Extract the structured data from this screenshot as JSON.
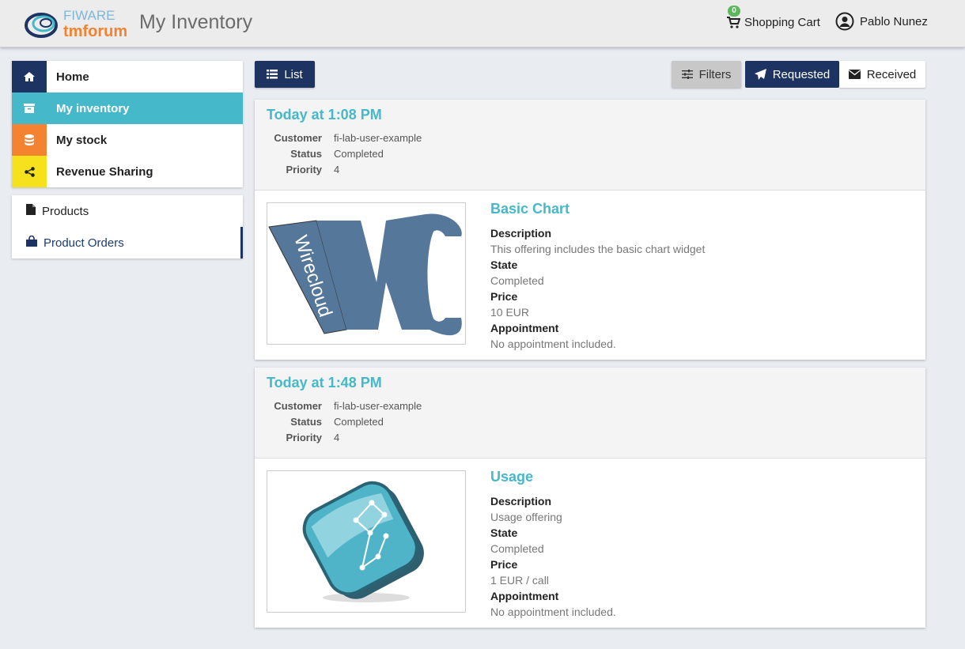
{
  "header": {
    "logo_top": "FIWARE",
    "logo_bottom": "tmforum",
    "title": "My Inventory",
    "cart_count": "0",
    "cart_label": "Shopping Cart",
    "user_name": "Pablo Nunez"
  },
  "sidebar": {
    "main_items": [
      {
        "label": "Home",
        "icon": "home-icon",
        "color": "#1d3361"
      },
      {
        "label": "My inventory",
        "icon": "archive-icon",
        "color": "#45b8c9"
      },
      {
        "label": "My stock",
        "icon": "database-icon",
        "color": "#f58231"
      },
      {
        "label": "Revenue Sharing",
        "icon": "share-icon",
        "color": "#f5e21d"
      }
    ],
    "sub_items": [
      {
        "label": "Products",
        "icon": "file-icon"
      },
      {
        "label": "Product Orders",
        "icon": "shopping-bag-icon"
      }
    ]
  },
  "toolbar": {
    "list_label": "List",
    "filters_label": "Filters",
    "requested_label": "Requested",
    "received_label": "Received"
  },
  "orders": [
    {
      "date": "Today at 1:08 PM",
      "customer_key": "Customer",
      "customer": "fi-lab-user-example",
      "status_key": "Status",
      "status": "Completed",
      "priority_key": "Priority",
      "priority": "4",
      "product": {
        "name": "Basic Chart",
        "image_text": "Wirecloud",
        "description_key": "Description",
        "description": "This offering includes the basic chart widget",
        "state_key": "State",
        "state": "Completed",
        "price_key": "Price",
        "price": "10 EUR",
        "appointment_key": "Appointment",
        "appointment": "No appointment included."
      }
    },
    {
      "date": "Today at 1:48 PM",
      "customer_key": "Customer",
      "customer": "fi-lab-user-example",
      "status_key": "Status",
      "status": "Completed",
      "priority_key": "Priority",
      "priority": "4",
      "product": {
        "name": "Usage",
        "description_key": "Description",
        "description": "Usage offering",
        "state_key": "State",
        "state": "Completed",
        "price_key": "Price",
        "price": "1 EUR / call",
        "appointment_key": "Appointment",
        "appointment": "No appointment included."
      }
    }
  ],
  "colors": {
    "accent": "#45b8c9",
    "navy": "#1d3361"
  }
}
